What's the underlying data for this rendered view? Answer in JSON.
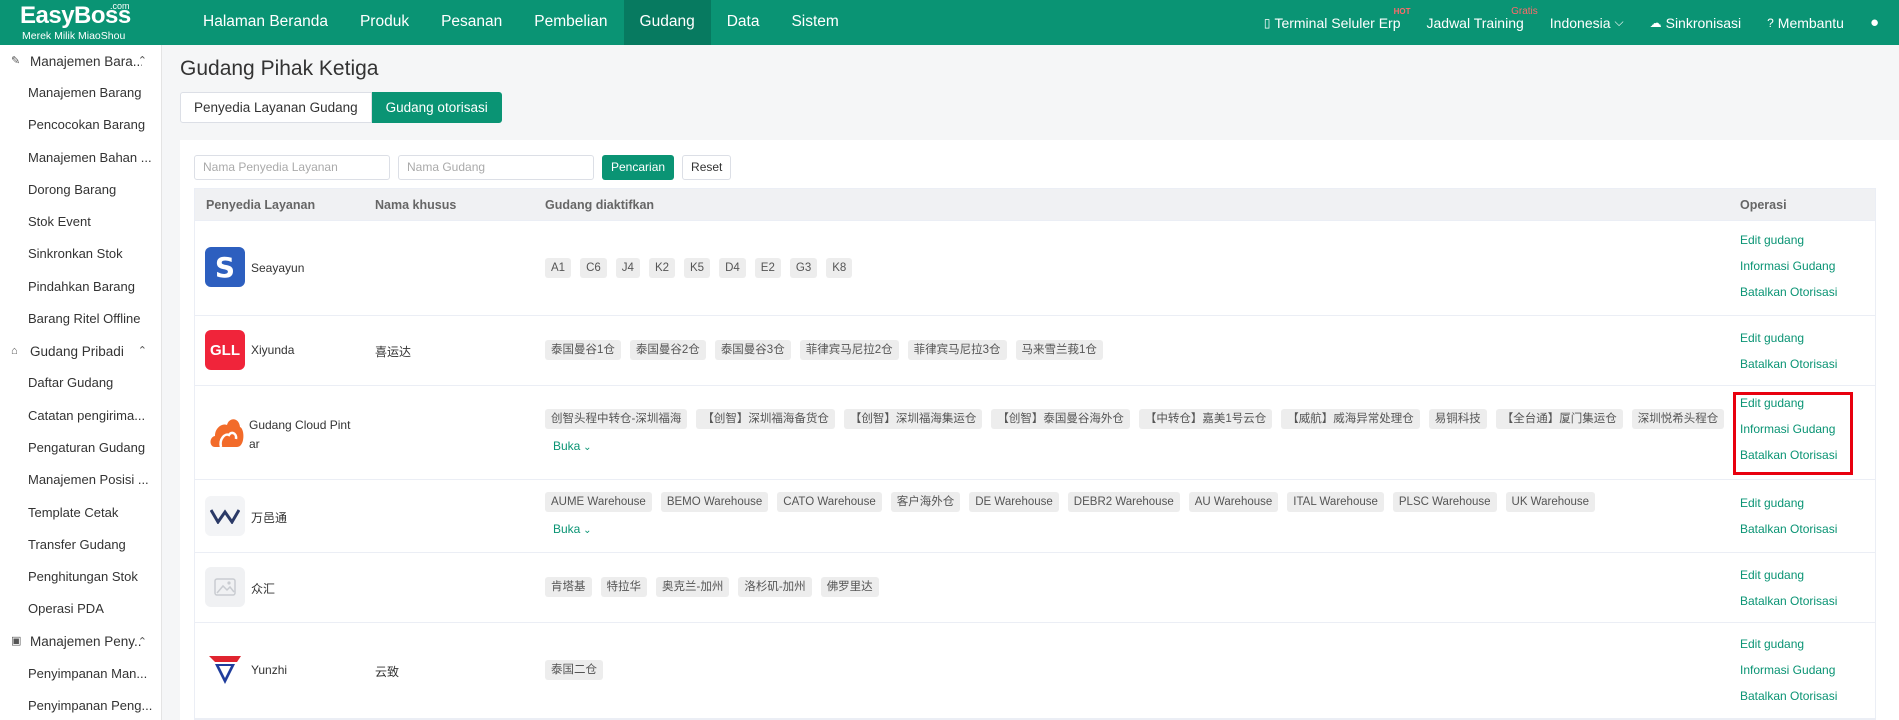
{
  "app": {
    "brand": "EasyBoss",
    "brand_suffix": ".com",
    "tagline": "Merek Milik MiaoShou",
    "accent": "#0a9474"
  },
  "nav": {
    "items": [
      "Halaman Beranda",
      "Produk",
      "Pesanan",
      "Pembelian",
      "Gudang",
      "Data",
      "Sistem"
    ],
    "active": "Gudang",
    "right": {
      "terminal": "Terminal Seluler Erp",
      "terminal_badge": "HOT",
      "training": "Jadwal Training",
      "training_badge": "Gratis",
      "language": "Indonesia",
      "sync": "Sinkronisasi",
      "help": "Membantu"
    }
  },
  "sidebar": {
    "groups": [
      {
        "label": "Manajemen Bara...",
        "items": [
          "Manajemen Barang",
          "Pencocokan Barang",
          "Manajemen Bahan ...",
          "Dorong Barang",
          "Stok Event",
          "Sinkronkan Stok",
          "Pindahkan Barang",
          "Barang Ritel Offline"
        ]
      },
      {
        "label": "Gudang Pribadi",
        "items": [
          "Daftar Gudang",
          "Catatan pengirima...",
          "Pengaturan Gudang",
          "Manajemen Posisi ...",
          "Template Cetak",
          "Transfer Gudang",
          "Penghitungan Stok",
          "Operasi PDA"
        ]
      },
      {
        "label": "Manajemen Peny...",
        "items": [
          "Penyimpanan Man...",
          "Penyimpanan Peng..."
        ]
      }
    ]
  },
  "page": {
    "title": "Gudang Pihak Ketiga",
    "tabs": [
      "Penyedia Layanan Gudang",
      "Gudang otorisasi"
    ],
    "active_tab": "Gudang otorisasi"
  },
  "search": {
    "provider_placeholder": "Nama Penyedia Layanan",
    "warehouse_placeholder": "Nama Gudang",
    "search_button": "Pencarian",
    "reset_button": "Reset"
  },
  "table": {
    "columns": [
      "Penyedia Layanan",
      "Nama khusus",
      "Gudang diaktifkan",
      "Operasi"
    ],
    "rows": [
      {
        "provider": "Seayayun",
        "alias": "",
        "warehouses": [
          "A1",
          "C6",
          "J4",
          "K2",
          "K5",
          "D4",
          "E2",
          "G3",
          "K8"
        ],
        "expand": "",
        "ops": [
          "Edit gudang",
          "Informasi Gudang",
          "Batalkan Otorisasi"
        ]
      },
      {
        "provider": "Xiyunda",
        "logo_text": "GLL",
        "alias": "喜运达",
        "warehouses": [
          "泰国曼谷1仓",
          "泰国曼谷2仓",
          "泰国曼谷3仓",
          "菲律宾马尼拉2仓",
          "菲律宾马尼拉3仓",
          "马来雪兰莪1仓"
        ],
        "expand": "",
        "ops": [
          "Edit gudang",
          "Batalkan Otorisasi"
        ]
      },
      {
        "provider": "Gudang Cloud Pint",
        "provider_line2": "ar",
        "alias": "",
        "warehouses": [
          "创智头程中转仓-深圳福海",
          "【创智】深圳福海备货仓",
          "【创智】深圳福海集运仓",
          "【创智】泰国曼谷海外仓",
          "【中转仓】嘉美1号云仓",
          "【威航】威海异常处理仓",
          "易铜科技",
          "【全台通】厦门集运仓",
          "深圳悦希头程仓"
        ],
        "expand": "Buka",
        "ops": [
          "Edit gudang",
          "Informasi Gudang",
          "Batalkan Otorisasi"
        ]
      },
      {
        "provider": "万邑通",
        "alias": "",
        "warehouses": [
          "AUME Warehouse",
          "BEMO Warehouse",
          "CATO Warehouse",
          "客户海外仓",
          "DE Warehouse",
          "DEBR2 Warehouse",
          "AU Warehouse",
          "ITAL Warehouse",
          "PLSC Warehouse",
          "UK Warehouse"
        ],
        "expand": "Buka",
        "ops": [
          "Edit gudang",
          "Batalkan Otorisasi"
        ]
      },
      {
        "provider": "众汇",
        "alias": "",
        "warehouses": [
          "肯塔基",
          "特拉华",
          "奥克兰-加州",
          "洛杉矶-加州",
          "佛罗里达"
        ],
        "expand": "",
        "ops": [
          "Edit gudang",
          "Batalkan Otorisasi"
        ]
      },
      {
        "provider": "Yunzhi",
        "alias": "云致",
        "warehouses": [
          "泰国二仓"
        ],
        "expand": "",
        "ops": [
          "Edit gudang",
          "Informasi Gudang",
          "Batalkan Otorisasi"
        ]
      }
    ]
  },
  "colors": {
    "highlight": "#e8000e",
    "seayayun": "#2d5fbf",
    "xiyunda": "#f0243a",
    "pintar": "#f26b2a"
  }
}
